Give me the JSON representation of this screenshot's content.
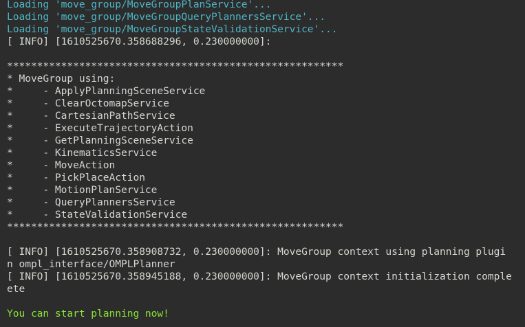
{
  "colors": {
    "background": "#2c2c2c",
    "text": "#d3d7cf",
    "loading": "#4fb4c4",
    "success": "#8ae234"
  },
  "terminal": {
    "lines": [
      {
        "text": "Loading 'move_group/MoveGroupPlanService'...",
        "style": "cyan"
      },
      {
        "text": "Loading 'move_group/MoveGroupQueryPlannersService'...",
        "style": "cyan"
      },
      {
        "text": "Loading 'move_group/MoveGroupStateValidationService'...",
        "style": "cyan"
      },
      {
        "text": "[ INFO] [1610525670.358688296, 0.230000000]:",
        "style": "white"
      },
      {
        "text": "",
        "style": "white"
      },
      {
        "text": "********************************************************",
        "style": "white"
      },
      {
        "text": "* MoveGroup using:",
        "style": "white"
      },
      {
        "text": "*     - ApplyPlanningSceneService",
        "style": "white"
      },
      {
        "text": "*     - ClearOctomapService",
        "style": "white"
      },
      {
        "text": "*     - CartesianPathService",
        "style": "white"
      },
      {
        "text": "*     - ExecuteTrajectoryAction",
        "style": "white"
      },
      {
        "text": "*     - GetPlanningSceneService",
        "style": "white"
      },
      {
        "text": "*     - KinematicsService",
        "style": "white"
      },
      {
        "text": "*     - MoveAction",
        "style": "white"
      },
      {
        "text": "*     - PickPlaceAction",
        "style": "white"
      },
      {
        "text": "*     - MotionPlanService",
        "style": "white"
      },
      {
        "text": "*     - QueryPlannersService",
        "style": "white"
      },
      {
        "text": "*     - StateValidationService",
        "style": "white"
      },
      {
        "text": "********************************************************",
        "style": "white"
      },
      {
        "text": "",
        "style": "white"
      },
      {
        "text": "[ INFO] [1610525670.358908732, 0.230000000]: MoveGroup context using planning plugi",
        "style": "white"
      },
      {
        "text": "n ompl_interface/OMPLPlanner",
        "style": "white"
      },
      {
        "text": "[ INFO] [1610525670.358945188, 0.230000000]: MoveGroup context initialization comple",
        "style": "white"
      },
      {
        "text": "ete",
        "style": "white"
      },
      {
        "text": "",
        "style": "white"
      },
      {
        "text": "You can start planning now!",
        "style": "green"
      }
    ]
  }
}
